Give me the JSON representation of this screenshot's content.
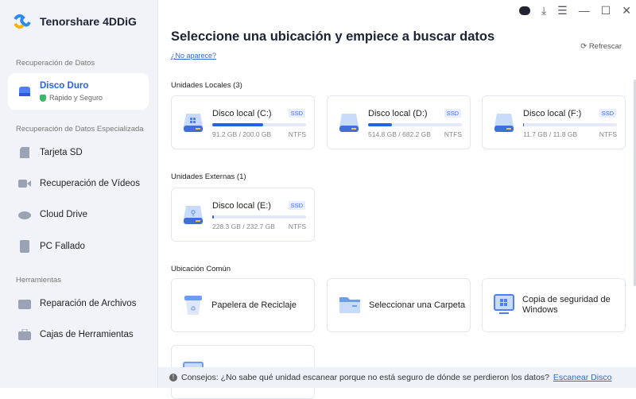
{
  "app": {
    "name": "Tenorshare 4DDiG"
  },
  "sidebar": {
    "sections": [
      "Recuperación de Datos",
      "Recuperación de Datos Especializada",
      "Herramientas"
    ],
    "active": {
      "label": "Disco Duro",
      "sub": "Rápido y Seguro"
    },
    "items": [
      {
        "label": "Tarjeta SD"
      },
      {
        "label": "Recuperación de Vídeos"
      },
      {
        "label": "Cloud Drive"
      },
      {
        "label": "PC Fallado"
      },
      {
        "label": "Reparación de Archivos"
      },
      {
        "label": "Cajas de Herramientas"
      }
    ]
  },
  "main": {
    "title": "Seleccione una ubicación y empiece a buscar datos",
    "not_shown_link": "¿No aparece?",
    "refresh": "Refrescar",
    "local_header": "Unidades Locales (3)",
    "external_header": "Unidades Externas (1)",
    "common_header": "Ubicación Común",
    "drives": [
      {
        "name": "Disco local (C:)",
        "badge": "SSD",
        "size": "91.2 GB / 200.0 GB",
        "fs": "NTFS",
        "used_percent": 54
      },
      {
        "name": "Disco local (D:)",
        "badge": "SSD",
        "size": "514.8 GB / 682.2 GB",
        "fs": "NTFS",
        "used_percent": 25
      },
      {
        "name": "Disco local (F:)",
        "badge": "SSD",
        "size": "11.7 GB / 11.8 GB",
        "fs": "NTFS",
        "used_percent": 1
      },
      {
        "name": "Disco local (E:)",
        "badge": "SSD",
        "size": "228.3 GB / 232.7 GB",
        "fs": "NTFS",
        "used_percent": 2
      }
    ],
    "common": [
      {
        "label": "Papelera de Reciclaje"
      },
      {
        "label": "Seleccionar una Carpeta"
      },
      {
        "label": "Copia de seguridad de Windows"
      }
    ]
  },
  "tip": {
    "text": "Consejos: ¿No sabe qué unidad escanear porque no está seguro de dónde se perdieron los datos?",
    "link": "Escanear Disco"
  },
  "colors": {
    "accent": "#2461f0",
    "sidebar_bg": "#f2f3f8"
  }
}
